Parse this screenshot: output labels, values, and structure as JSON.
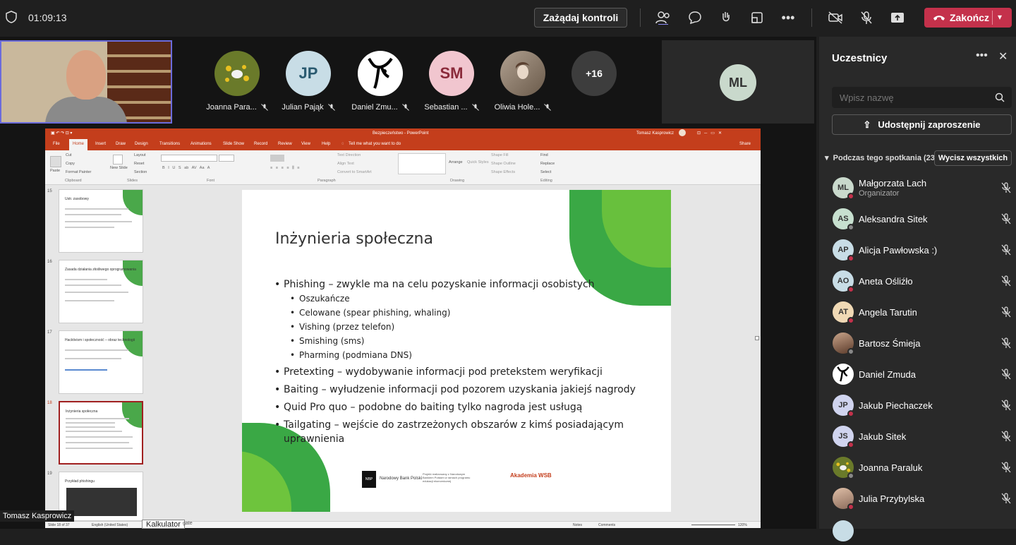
{
  "topbar": {
    "time": "01:09:13",
    "request_control": "Zażądaj kontroli",
    "end_label": "Zakończ"
  },
  "strip": {
    "participants": [
      {
        "name": "Joanna Para...",
        "color": "#6a7a2a",
        "initials": ""
      },
      {
        "name": "Julian Pająk",
        "color": "#c8dde6",
        "initials": "JP"
      },
      {
        "name": "Daniel Zmu...",
        "color": "#ffffff",
        "initials": ""
      },
      {
        "name": "Sebastian ...",
        "color": "#f1c6cf",
        "initials": "SM"
      },
      {
        "name": "Oliwia Hole...",
        "color": "#9a8a7a",
        "initials": ""
      }
    ],
    "more_count": "+16",
    "ml_initials": "ML"
  },
  "ppt": {
    "window_title": "Bezpieczeństwo - PowerPoint",
    "user": "Tomasz Kasprowicz",
    "tabs": [
      "File",
      "Home",
      "Insert",
      "Draw",
      "Design",
      "Transitions",
      "Animations",
      "Slide Show",
      "Record",
      "Review",
      "View",
      "Help"
    ],
    "tell_me": "Tell me what you want to do",
    "share": "Share",
    "ribbon": {
      "cut": "Cut",
      "copy": "Copy",
      "format_painter": "Format Painter",
      "paste": "Paste",
      "new_slide": "New Slide",
      "layout": "Layout",
      "reset": "Reset",
      "section": "Section",
      "clipboard": "Clipboard",
      "slides": "Slides",
      "font": "Font",
      "paragraph": "Paragraph",
      "drawing": "Drawing",
      "editing": "Editing",
      "find": "Find",
      "replace": "Replace",
      "select": "Select",
      "arrange": "Arrange",
      "quick_styles": "Quick Styles",
      "shape_fill": "Shape Fill",
      "shape_outline": "Shape Outline",
      "shape_effects": "Shape Effects",
      "text_direction": "Text Direction",
      "align_text": "Align Text",
      "convert_smartart": "Convert to SmartArt"
    },
    "thumbnails": [
      {
        "num": "15",
        "title": "Ustr. zasobowy"
      },
      {
        "num": "16",
        "title": "Zasada działania złośliwego oprogramowania"
      },
      {
        "num": "17",
        "title": "Hacktivism i społeczność – obraz technologii"
      },
      {
        "num": "18",
        "title": "Inżynieria społeczna"
      },
      {
        "num": "19",
        "title": "Przykład phishingu"
      }
    ],
    "slide": {
      "title": "Inżynieria społeczna",
      "b1": "Phishing – zwykle ma na celu pozyskanie informacji osobistych",
      "s1": "Oszukańcze",
      "s2": "Celowane (spear phishing, whaling)",
      "s3": "Vishing (przez telefon)",
      "s4": "Smishing (sms)",
      "s5": "Pharming (podmiana DNS)",
      "b2": "Pretexting – wydobywanie informacji pod pretekstem weryfikacji",
      "b3": "Baiting – wyłudzenie informacji pod pozorem uzyskania jakiejś nagrody",
      "b4": "Quid Pro quo – podobne do baiting tylko nagroda jest usługą",
      "b5": "Tailgating – wejście do zastrzeżonych obszarów z kimś posiadającym uprawnienia",
      "nbp_short": "NBP",
      "nbp_name": "Narodowy Bank Polski",
      "project": "Projekt realizowany z Narodowym Bankiem Polskim w ramach programu edukacji ekonomicznej",
      "wsb": "Akademia WSB"
    },
    "status": {
      "slide_of": "Slide 18 of 37",
      "lang": "English (United States)",
      "notes": "Notes",
      "comments": "Comments",
      "zoom": "120%"
    }
  },
  "presenter_label": "Tomasz Kasprowicz",
  "kalk_label": "Kalkulator",
  "kalk_suffix": "gate",
  "panel": {
    "title": "Uczestnicy",
    "search_placeholder": "Wpisz nazwę",
    "invite": "Udostępnij zaproszenie",
    "section": "Podczas tego spotkania (23)",
    "mute_all": "Wycisz wszystkich",
    "people": [
      {
        "name": "Małgorzata Lach",
        "role": "Organizator",
        "initials": "ML",
        "color": "#c9d9cc"
      },
      {
        "name": "Aleksandra Sitek",
        "role": "",
        "initials": "AS",
        "color": "#c7e0cf"
      },
      {
        "name": "Alicja Pawłowska :)",
        "role": "",
        "initials": "AP",
        "color": "#c8dde6"
      },
      {
        "name": "Aneta Ośliźło",
        "role": "",
        "initials": "AO",
        "color": "#c8dde6"
      },
      {
        "name": "Angela Tarutin",
        "role": "",
        "initials": "AT",
        "color": "#f0d9b5"
      },
      {
        "name": "Bartosz Śmieja",
        "role": "",
        "initials": "",
        "color": "#8a6a5a"
      },
      {
        "name": "Daniel Zmuda",
        "role": "",
        "initials": "",
        "color": "#ffffff"
      },
      {
        "name": "Jakub Piechaczek",
        "role": "",
        "initials": "JP",
        "color": "#d0d4ef"
      },
      {
        "name": "Jakub Sitek",
        "role": "",
        "initials": "JS",
        "color": "#d0d4ef"
      },
      {
        "name": "Joanna Paraluk",
        "role": "",
        "initials": "",
        "color": "#6a7a2a"
      },
      {
        "name": "Julia Przybylska",
        "role": "",
        "initials": "",
        "color": "#c9a48a"
      }
    ]
  }
}
